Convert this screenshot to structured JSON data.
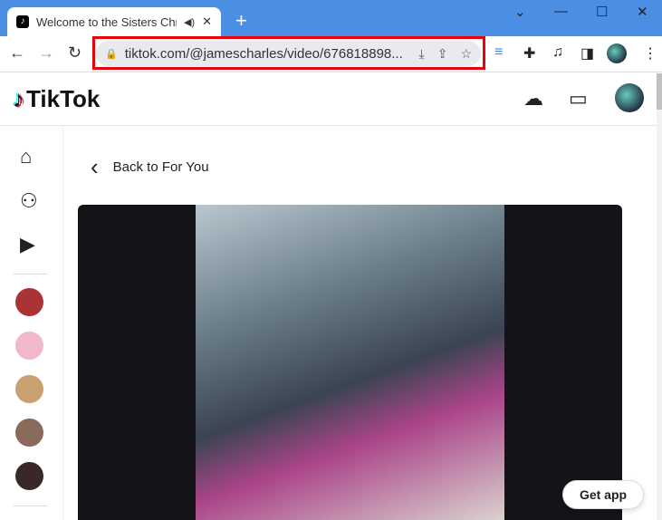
{
  "browser": {
    "tab": {
      "title": "Welcome to the Sisters Christmas",
      "audio_icon": "speaker-icon",
      "close": "✕"
    },
    "new_tab": "+",
    "window_controls": {
      "menu": "⌄",
      "minimize": "—",
      "maximize": "☐",
      "close": "✕"
    },
    "nav": {
      "back": "←",
      "forward": "→",
      "reload": "↻"
    },
    "address": {
      "url": "tiktok.com/@jamescharles/video/676818898...",
      "lock": "🔒",
      "install": "⤓",
      "share": "⇪",
      "star": "☆"
    },
    "highlight_color": "#e8000b"
  },
  "tiktok": {
    "logo": "TikTok",
    "header_icons": [
      "upload-icon",
      "inbox-icon",
      "profile-avatar"
    ],
    "sidebar": {
      "items": [
        "home-icon",
        "following-icon",
        "live-icon"
      ],
      "accounts": 5
    },
    "back_label": "Back to For You",
    "get_app": "Get app"
  }
}
